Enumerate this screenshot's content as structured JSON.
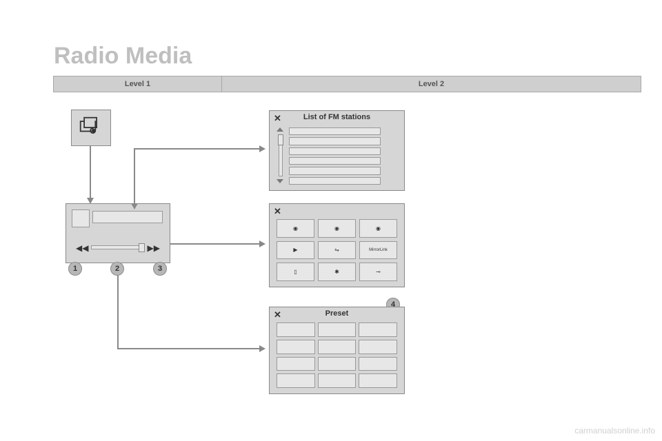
{
  "page": {
    "title": "Radio Media",
    "watermark": "carmanualsonline.info"
  },
  "header": {
    "level1": "Level 1",
    "level2": "Level 2"
  },
  "fm_panel": {
    "title": "List of FM stations",
    "close": "✕"
  },
  "source_panel": {
    "close": "✕",
    "cells": [
      {
        "name": "radio-a-icon",
        "glyph": "◉"
      },
      {
        "name": "radio-b-icon",
        "glyph": "◉"
      },
      {
        "name": "radio-c-icon",
        "glyph": "◉"
      },
      {
        "name": "play-icon",
        "glyph": "▶"
      },
      {
        "name": "usb-icon",
        "glyph": "⇋"
      },
      {
        "name": "mirrorlink-icon",
        "glyph": "MirrorLink"
      },
      {
        "name": "ipod-icon",
        "glyph": "▯"
      },
      {
        "name": "bluetooth-icon",
        "glyph": "✱"
      },
      {
        "name": "aux-icon",
        "glyph": "⊸"
      }
    ]
  },
  "preset_panel": {
    "title": "Preset",
    "close": "✕"
  },
  "markers": {
    "m1": "1",
    "m2": "2",
    "m3": "3",
    "m4": "4"
  }
}
